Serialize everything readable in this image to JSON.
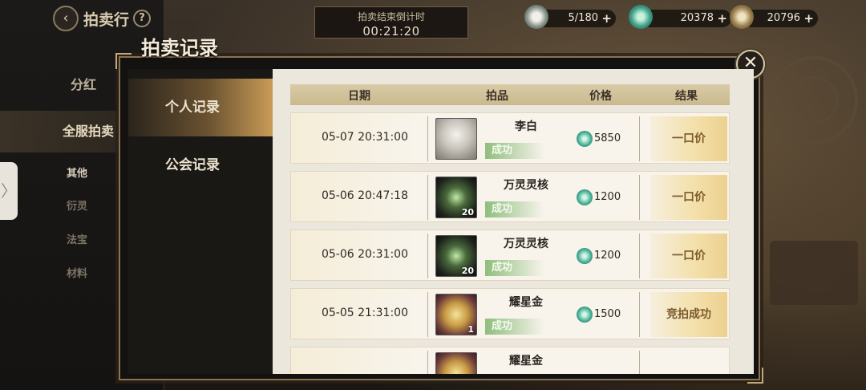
{
  "header": {
    "title": "拍卖行",
    "help": "?",
    "back": "‹"
  },
  "sidebar": {
    "items": [
      {
        "label": "分红"
      },
      {
        "label": "全服拍卖"
      },
      {
        "label": "其他"
      },
      {
        "label": "衍灵"
      },
      {
        "label": "法宝"
      },
      {
        "label": "材料"
      }
    ],
    "drawer_glyph": "〉"
  },
  "timer": {
    "label": "拍卖结束倒计时",
    "value": "00:21:20"
  },
  "resources": [
    {
      "icon": "pearl-currency-icon",
      "value": "5/180"
    },
    {
      "icon": "jade-gem-icon",
      "value": "20378"
    },
    {
      "icon": "gold-medal-icon",
      "value": "20796"
    }
  ],
  "plus": "+",
  "modal": {
    "title": "拍卖记录",
    "close": "✕",
    "tabs": [
      {
        "label": "个人记录",
        "active": true
      },
      {
        "label": "公会记录",
        "active": false
      }
    ],
    "columns": {
      "date": "日期",
      "item": "拍品",
      "price": "价格",
      "result": "结果"
    },
    "records": [
      {
        "date": "05-07 20:31:00",
        "item": "李白",
        "icon": "character-portrait-icon",
        "qty": "",
        "status": "成功",
        "price": "5850",
        "result": "一口价"
      },
      {
        "date": "05-06 20:47:18",
        "item": "万灵灵核",
        "icon": "spirit-core-icon",
        "qty": "20",
        "status": "成功",
        "price": "1200",
        "result": "一口价"
      },
      {
        "date": "05-06 20:31:00",
        "item": "万灵灵核",
        "icon": "spirit-core-icon",
        "qty": "20",
        "status": "成功",
        "price": "1200",
        "result": "一口价"
      },
      {
        "date": "05-05 21:31:00",
        "item": "耀星金",
        "icon": "star-gold-icon",
        "qty": "1",
        "status": "成功",
        "price": "1500",
        "result": "竞拍成功"
      },
      {
        "date": "",
        "item": "耀星金",
        "icon": "star-gold-icon",
        "qty": "",
        "status": "",
        "price": "",
        "result": ""
      }
    ]
  }
}
